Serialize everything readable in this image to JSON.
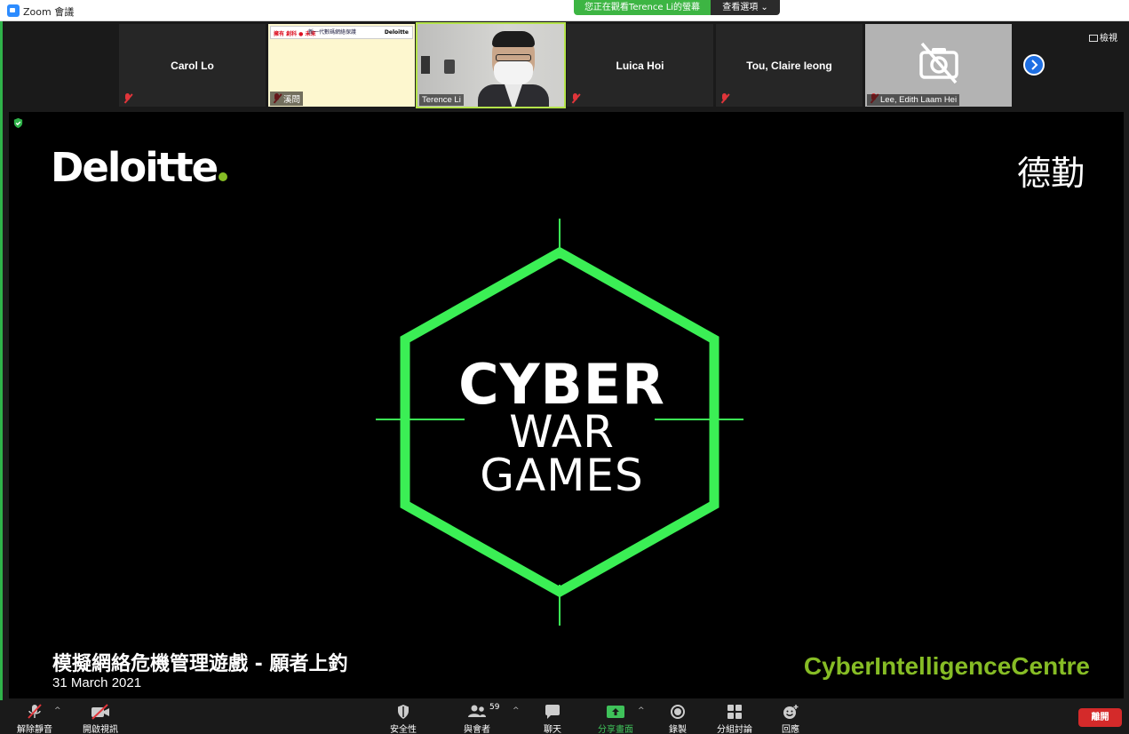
{
  "window": {
    "title": "Zoom 會議"
  },
  "banner": {
    "viewing": "您正在觀看Terence Li的螢幕",
    "view_options": "查看選項 ⌄"
  },
  "participants": {
    "tile1_name": "Carol Lo",
    "tile2_name": "溪問",
    "tile3_name": "Terence Li",
    "tile4_name": "Luica Hoi",
    "tile5_name": "Tou, Claire Ieong",
    "tile6_name": "Lee, Edith Laam Hei",
    "mini_banner_a": "擁有 創科 ● 未來",
    "mini_banner_b": "新一代數碼網絡保護",
    "mini_banner_c": "Deloitte"
  },
  "view_toggle": "檢視",
  "slide": {
    "logo": "Deloitte",
    "logo_cn": "德勤",
    "line1": "CYBER",
    "line2": "WAR",
    "line3": "GAMES",
    "subtitle": "模擬網絡危機管理遊戲 - 願者上釣",
    "date": "31 March 2021",
    "centre": "CyberIntelligenceCentre"
  },
  "colors": {
    "brand_green": "#86bc25",
    "hex_green": "#3bef55",
    "end_red": "#d42a2a"
  },
  "toolbar": {
    "unmute": "解除靜音",
    "start_video": "開啟視訊",
    "security": "安全性",
    "participants": "與會者",
    "participants_count": "59",
    "chat": "聊天",
    "share": "分享畫面",
    "record": "錄製",
    "breakout": "分組討論",
    "reactions": "回應",
    "end": "離開"
  }
}
